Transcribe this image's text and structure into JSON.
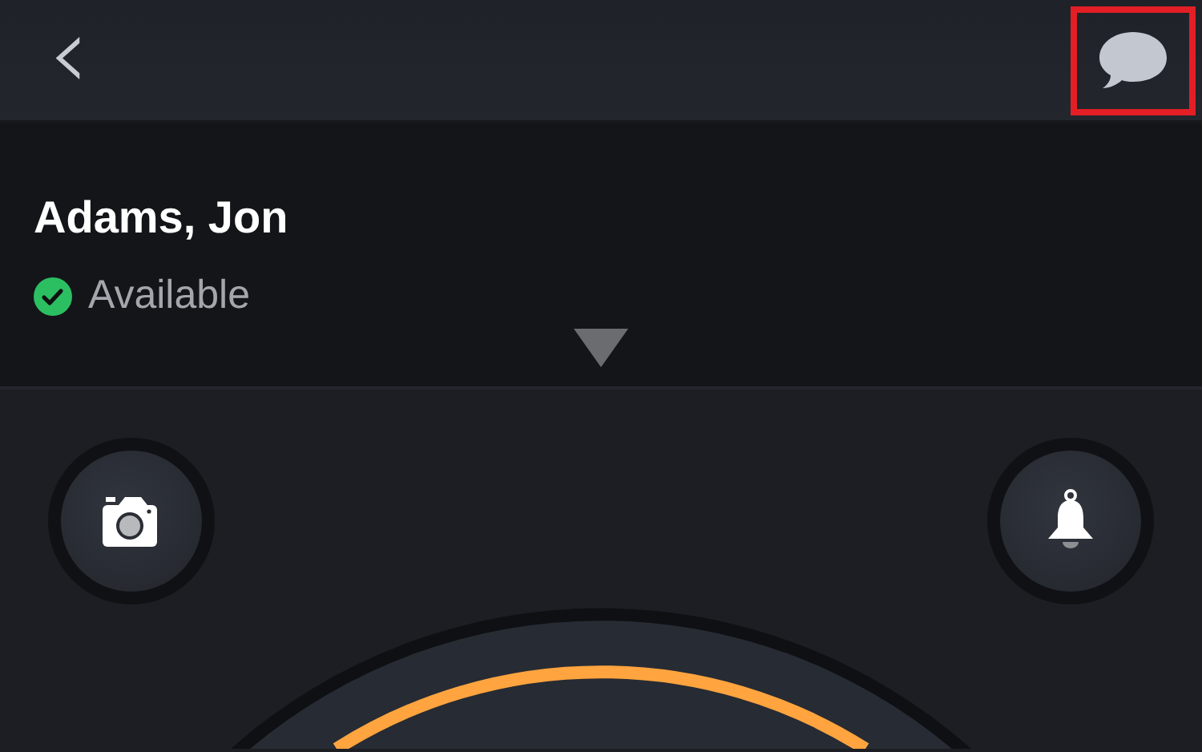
{
  "header": {
    "back_label": "‹",
    "chat": {
      "highlighted": true
    }
  },
  "contact": {
    "name": "Adams, Jon",
    "status": {
      "label": "Available",
      "kind": "available"
    },
    "expanded": false
  },
  "actions": [
    {
      "kind": "camera"
    },
    {
      "kind": "alert"
    }
  ],
  "dial": {
    "active": true
  }
}
